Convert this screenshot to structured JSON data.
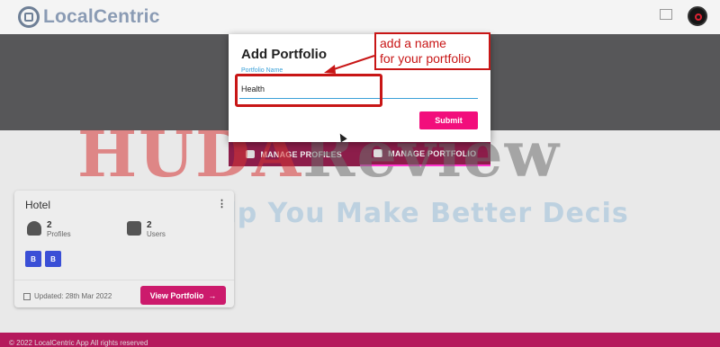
{
  "header": {
    "app_name": "LocalCentric",
    "logo_icon": "localcentric-logo-icon",
    "expand_icon": "fullscreen-icon",
    "avatar_icon": "user-avatar-icon"
  },
  "tabs": [
    {
      "label": "MANAGE PROFILES",
      "icon": "person-icon",
      "active": false
    },
    {
      "label": "MANAGE PORTFOLIO",
      "icon": "folder-icon",
      "active": true
    }
  ],
  "card": {
    "title": "Hotel",
    "menu_icon": "more-vert-icon",
    "profiles_count": "2",
    "profiles_label": "Profiles",
    "users_count": "2",
    "users_label": "Users",
    "badges": [
      "B",
      "B"
    ],
    "updated": "Updated: 28th Mar 2022",
    "view_button": "View Portfolio",
    "colors": {
      "button": "#cc1a6c",
      "badge": "#3a4fd6"
    }
  },
  "footer": {
    "copyright": "© 2022 LocalCentric App All rights reserved"
  },
  "modal": {
    "title": "Add Portfolio",
    "field_label": "Portfolio Name",
    "field_value": "Health",
    "submit_label": "Submit",
    "colors": {
      "submit": "#f20e7c",
      "accent": "#3aa0d8"
    }
  },
  "annotation": {
    "callout_line1": "add a name",
    "callout_line2": "for your portfolio",
    "color": "#c81616"
  },
  "watermark": {
    "brand_part1": "HUDA",
    "brand_part2": "Review",
    "tagline": "Help You Make Better Decis"
  }
}
